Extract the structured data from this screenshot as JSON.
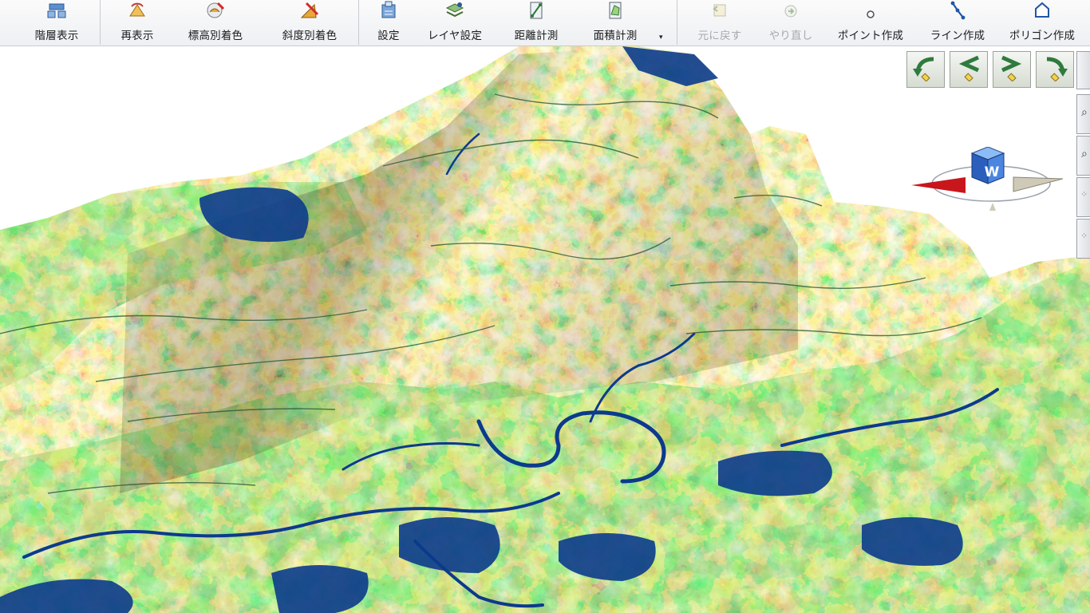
{
  "toolbar": {
    "buttons": [
      {
        "label": "階層表示",
        "icon": "layer-tree-icon",
        "enabled": true
      },
      {
        "label": "再表示",
        "icon": "redisplay-icon",
        "enabled": true
      },
      {
        "label": "標高別着色",
        "icon": "elevation-color-icon",
        "enabled": true
      },
      {
        "label": "斜度別着色",
        "icon": "slope-color-icon",
        "enabled": true
      },
      {
        "label": "設定",
        "icon": "settings-icon",
        "enabled": true
      },
      {
        "label": "レイヤ設定",
        "icon": "layer-settings-icon",
        "enabled": true
      },
      {
        "label": "距離計測",
        "icon": "distance-measure-icon",
        "enabled": true
      },
      {
        "label": "面積計測",
        "icon": "area-measure-icon",
        "enabled": true
      },
      {
        "label": "元に戻す",
        "icon": "undo-icon",
        "enabled": false
      },
      {
        "label": "やり直し",
        "icon": "redo-icon",
        "enabled": false
      },
      {
        "label": "ポイント作成",
        "icon": "point-create-icon",
        "enabled": true
      },
      {
        "label": "ライン作成",
        "icon": "line-create-icon",
        "enabled": true
      },
      {
        "label": "ポリゴン作成",
        "icon": "polygon-create-icon",
        "enabled": true
      }
    ],
    "more_glyph": "▾"
  },
  "compass": {
    "heading_label": "W",
    "north_color": "#c8161d"
  },
  "map": {
    "view": "3d-terrain",
    "color_scheme": [
      "#0a3d8f",
      "#1f9b2a",
      "#7fd321",
      "#f2a91b",
      "#e07b12",
      "#9c6330"
    ]
  }
}
